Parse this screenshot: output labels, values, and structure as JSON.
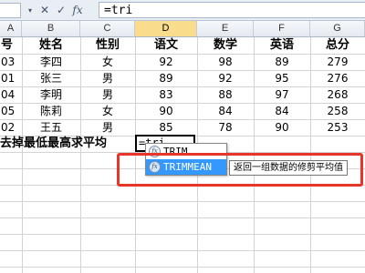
{
  "formula_bar": {
    "buttons": [
      {
        "name": "namebox-dropdown-icon",
        "glyph": "▾"
      },
      {
        "name": "cancel-icon",
        "glyph": "✕"
      },
      {
        "name": "enter-icon",
        "glyph": "✓"
      },
      {
        "name": "insert-function-icon",
        "glyph": "fx"
      }
    ],
    "value": "=tri"
  },
  "columns": [
    {
      "letter": "A",
      "active": false
    },
    {
      "letter": "B",
      "active": false
    },
    {
      "letter": "C",
      "active": false
    },
    {
      "letter": "D",
      "active": true
    },
    {
      "letter": "E",
      "active": false
    },
    {
      "letter": "F",
      "active": false
    },
    {
      "letter": "G",
      "active": false
    }
  ],
  "table": {
    "headers": [
      "号",
      "姓名",
      "性别",
      "语文",
      "数学",
      "英语",
      "总分"
    ],
    "rows": [
      [
        "03",
        "李四",
        "女",
        "92",
        "98",
        "89",
        "279"
      ],
      [
        "01",
        "张三",
        "男",
        "89",
        "92",
        "95",
        "276"
      ],
      [
        "04",
        "李明",
        "男",
        "83",
        "88",
        "97",
        "268"
      ],
      [
        "05",
        "陈莉",
        "女",
        "90",
        "84",
        "84",
        "258"
      ],
      [
        "02",
        "王五",
        "男",
        "85",
        "78",
        "90",
        "253"
      ]
    ]
  },
  "label_row": {
    "label": "去掉最低最高求平均",
    "editing_value": "=tri"
  },
  "autocomplete": {
    "items": [
      {
        "icon": "function-icon",
        "label": "TRIM",
        "selected": false
      },
      {
        "icon": "function-icon",
        "label": "TRIMMEAN",
        "selected": true
      }
    ],
    "tooltip": "返回一组数据的修剪平均值"
  },
  "colors": {
    "selected_item": "#3399ff",
    "highlight_border": "#e8352a",
    "active_column_header": "#f9dd8c"
  }
}
